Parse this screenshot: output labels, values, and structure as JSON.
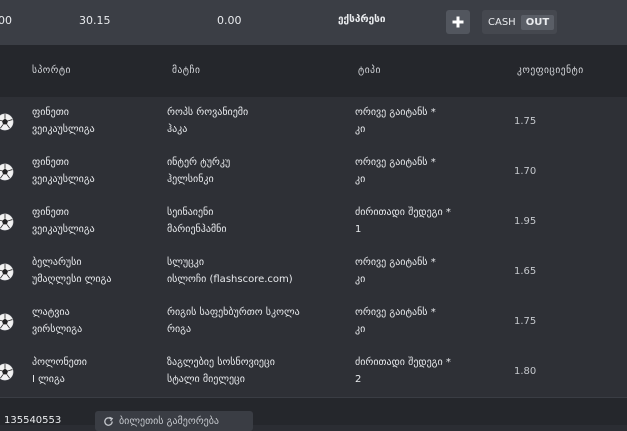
{
  "summary": {
    "value_a": "00",
    "value_b": "30.15",
    "value_c": "0.00",
    "bet_type": "ექსპრესი",
    "cash_label": "CASH",
    "out_label": "OUT"
  },
  "columns": [
    "სპორტი",
    "მატჩი",
    "ტიპი",
    "კოეფიციენტი"
  ],
  "rows": [
    {
      "sport_icon": "soccer-ball-icon",
      "league": [
        "ფინეთი",
        "ვეიკაუსლიგა"
      ],
      "match": [
        "როპს როვანიემი",
        "ჰაკა"
      ],
      "type": [
        "ორივე გაიტანს *",
        "კი"
      ],
      "odds": "1.75"
    },
    {
      "sport_icon": "soccer-ball-icon",
      "league": [
        "ფინეთი",
        "ვეიკაუსლიგა"
      ],
      "match": [
        "ინტერ ტურკუ",
        "ჰელსინკი"
      ],
      "type": [
        "ორივე გაიტანს *",
        "კი"
      ],
      "odds": "1.70"
    },
    {
      "sport_icon": "soccer-ball-icon",
      "league": [
        "ფინეთი",
        "ვეიკაუსლიგა"
      ],
      "match": [
        "სეინაიენი",
        "მარიენჰამნი"
      ],
      "type": [
        "ძირითადი შედეგი *",
        "1"
      ],
      "odds": "1.95"
    },
    {
      "sport_icon": "soccer-ball-icon",
      "league": [
        "ბელარუსი",
        "უმაღლესი ლიგა"
      ],
      "match": [
        "სლუცკი",
        "ისლოჩი (flashscore.com)"
      ],
      "type": [
        "ორივე გაიტანს *",
        "კი"
      ],
      "odds": "1.65"
    },
    {
      "sport_icon": "soccer-ball-icon",
      "league": [
        "ლატვია",
        "ვირსლიგა"
      ],
      "match": [
        "რიგის საფეხბურთო სკოლა",
        "რიგა"
      ],
      "type": [
        "ორივე გაიტანს *",
        "კი"
      ],
      "odds": "1.75"
    },
    {
      "sport_icon": "soccer-ball-icon",
      "league": [
        "პოლონეთი",
        "I ლიგა"
      ],
      "match": [
        "ზაგლებიე სოსნოვიეცი",
        "სტალი მიელეცი"
      ],
      "type": [
        "ძირითადი შედეგი *",
        "2"
      ],
      "odds": "1.80"
    }
  ],
  "footer": {
    "ticket_id": "135540553",
    "share_label": "ბილეთის გამეორება"
  },
  "colors": {
    "background": "#2b2d33",
    "topbar": "#3b3e45",
    "header": "#25272c",
    "row": "#2e3036",
    "divider": "#3a3d44"
  }
}
